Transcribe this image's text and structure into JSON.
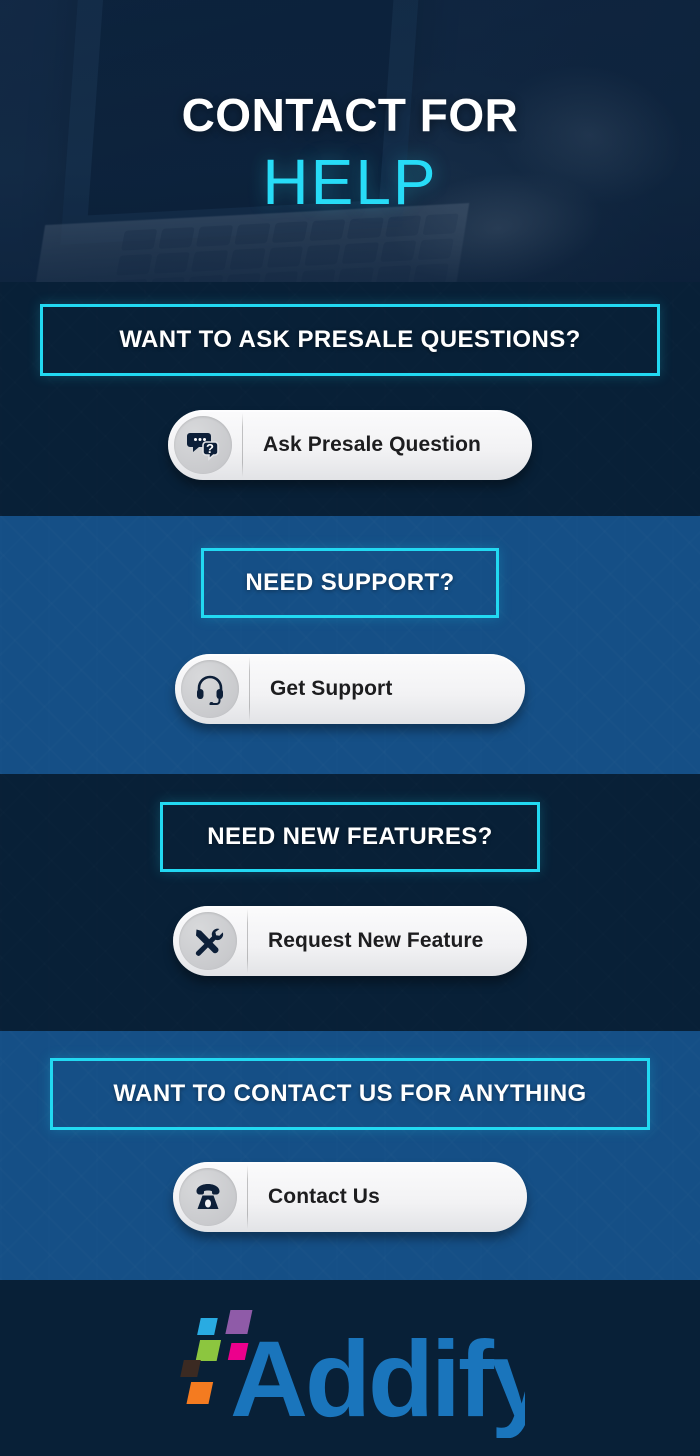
{
  "hero": {
    "line1": "CONTACT FOR",
    "line2": "HELP",
    "background_image": "laptop-typing-photo",
    "overlay_color": "#0c213a",
    "accent_color": "#27dcf7"
  },
  "theme": {
    "dark_section_bg": "#082037",
    "blue_section_bg": "#154f86",
    "cyan_border": "#22d9f2",
    "button_bg": "#f2f2f4",
    "button_text": "#1d1d1f",
    "logo_blue": "#1a75bc"
  },
  "sections": [
    {
      "id": "presale",
      "variant": "dark",
      "headline": "WANT TO ASK PRESALE QUESTIONS?",
      "button_label": "Ask Presale Question",
      "icon": "question-bubble-icon"
    },
    {
      "id": "support",
      "variant": "blue",
      "headline": "NEED SUPPORT?",
      "button_label": "Get Support",
      "icon": "headset-icon"
    },
    {
      "id": "features",
      "variant": "dark",
      "headline": "NEED NEW FEATURES?",
      "button_label": "Request New Feature",
      "icon": "tools-icon"
    },
    {
      "id": "contact",
      "variant": "blue",
      "headline": "WANT TO CONTACT US FOR ANYTHING",
      "button_label": "Contact Us",
      "icon": "telephone-icon"
    }
  ],
  "footer": {
    "brand": "Addify",
    "logo_mark_colors": [
      "#29abe2",
      "#8f5ba8",
      "#8cc63f",
      "#3b2a22",
      "#ec008c",
      "#f47b20"
    ]
  }
}
